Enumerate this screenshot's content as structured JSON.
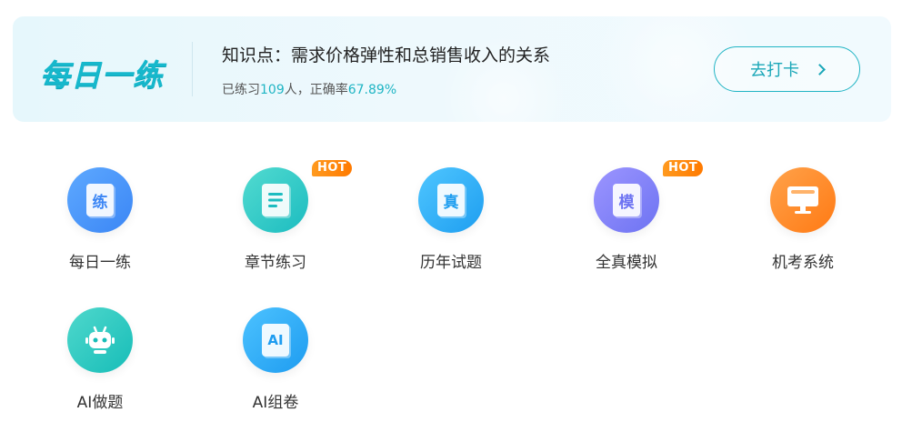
{
  "banner": {
    "logo_main": "每日一练",
    "title": "知识点：需求价格弹性和总销售收入的关系",
    "stats_prefix": "已练习",
    "practiced_count": "109",
    "stats_mid": "人，正确率",
    "accuracy": "67.89%",
    "cta_label": "去打卡"
  },
  "badge_label": "HOT",
  "features": [
    {
      "label": "每日一练",
      "glyph": "练",
      "hot": false,
      "color_from": "#5ea9ff",
      "color_to": "#3b86f5"
    },
    {
      "label": "章节练习",
      "glyph": "",
      "hot": true,
      "color_from": "#52dbd0",
      "color_to": "#1cbcc0"
    },
    {
      "label": "历年试题",
      "glyph": "真",
      "hot": false,
      "color_from": "#4fc6ff",
      "color_to": "#1e9ef0"
    },
    {
      "label": "全真模拟",
      "glyph": "模",
      "hot": true,
      "color_from": "#9c95ff",
      "color_to": "#6d73f2"
    },
    {
      "label": "机考系统",
      "glyph": "",
      "hot": false,
      "color_from": "#ffa24a",
      "color_to": "#ff7a14"
    },
    {
      "label": "AI做题",
      "glyph": "",
      "hot": false,
      "color_from": "#4fd8cc",
      "color_to": "#17bdb8"
    },
    {
      "label": "AI组卷",
      "glyph": "AI",
      "hot": false,
      "color_from": "#4cc2ff",
      "color_to": "#1e9cf0"
    }
  ]
}
